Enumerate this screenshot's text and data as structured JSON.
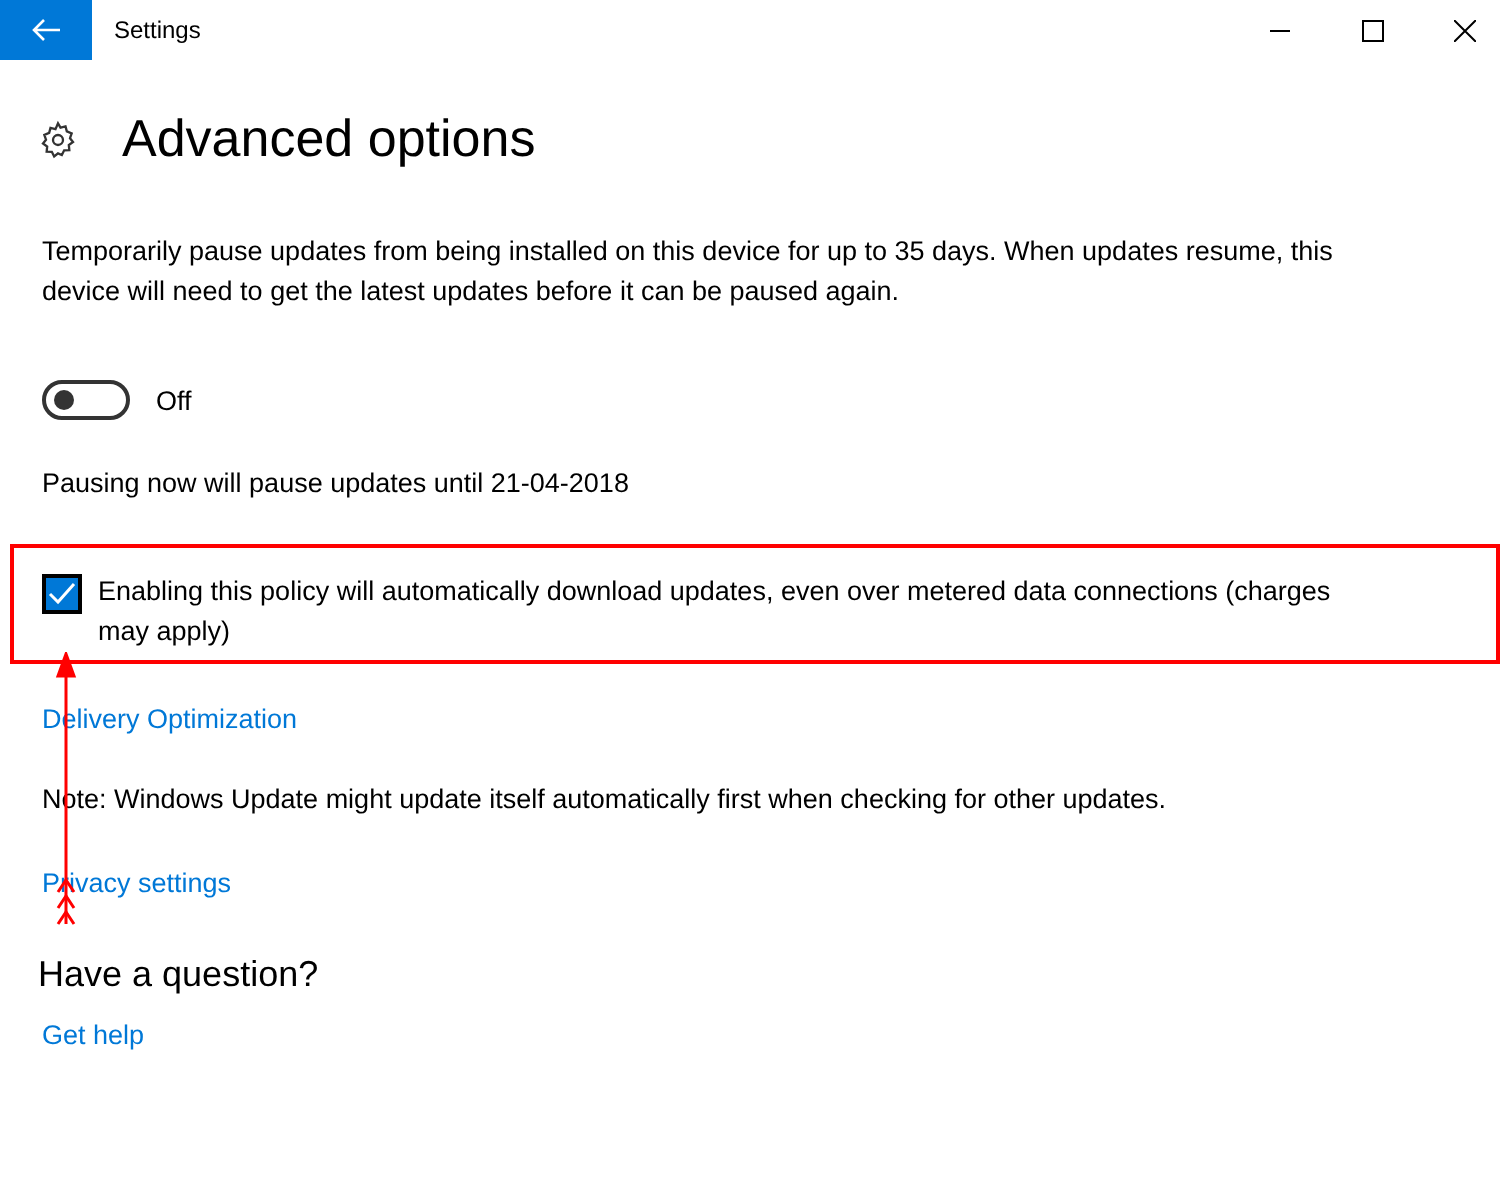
{
  "window": {
    "title": "Settings"
  },
  "page": {
    "title": "Advanced options"
  },
  "pause": {
    "description": "Temporarily pause updates from being installed on this device for up to 35 days. When updates resume, this device will need to get the latest updates before it can be paused again.",
    "toggle": {
      "on": false,
      "label": "Off"
    },
    "note": "Pausing now will pause updates until 21-04-2018"
  },
  "metered": {
    "checked": true,
    "label": "Enabling this policy will automatically download updates, even over metered data connections (charges may apply)"
  },
  "delivery_link": "Delivery Optimization",
  "note": "Note: Windows Update might update itself automatically first when checking for other updates.",
  "privacy_link": "Privacy settings",
  "question": {
    "heading": "Have a question?",
    "link": "Get help"
  }
}
